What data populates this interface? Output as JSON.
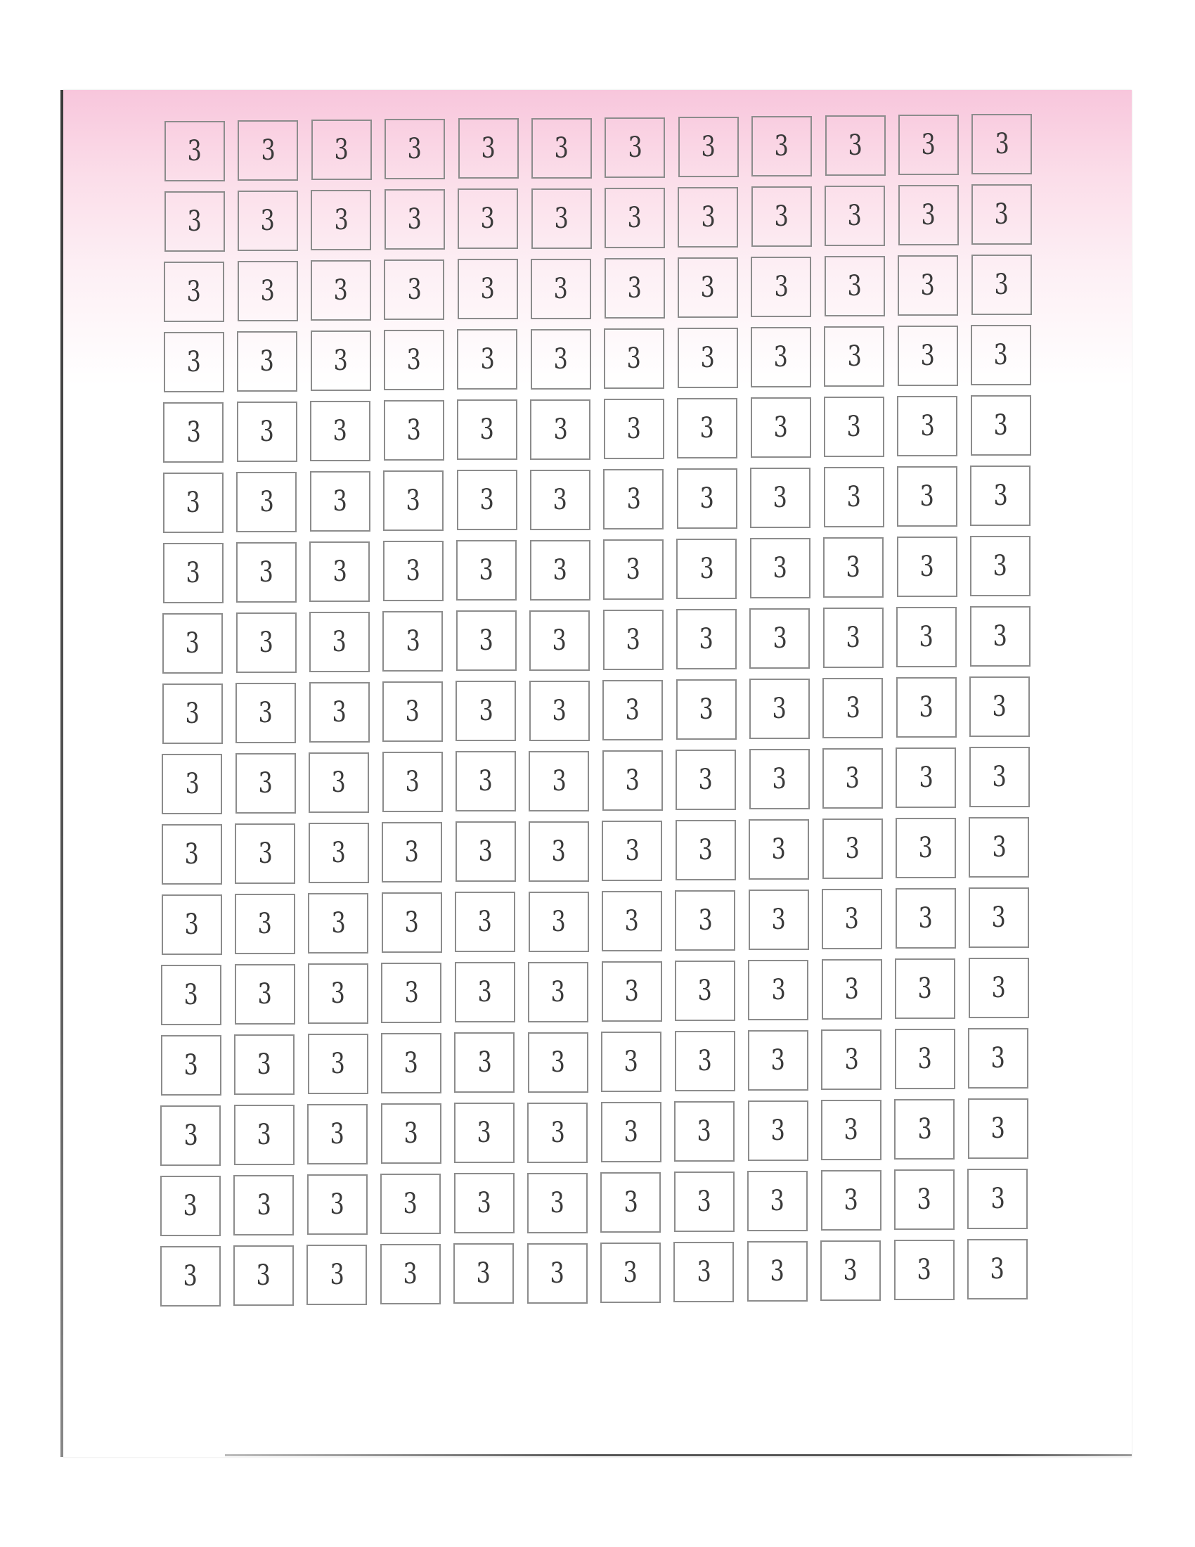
{
  "worksheet": {
    "rows": 17,
    "columns": 12,
    "cell_text": "3",
    "cells": [
      [
        "3",
        "3",
        "3",
        "3",
        "3",
        "3",
        "3",
        "3",
        "3",
        "3",
        "3",
        "3"
      ],
      [
        "3",
        "3",
        "3",
        "3",
        "3",
        "3",
        "3",
        "3",
        "3",
        "3",
        "3",
        "3"
      ],
      [
        "3",
        "3",
        "3",
        "3",
        "3",
        "3",
        "3",
        "3",
        "3",
        "3",
        "3",
        "3"
      ],
      [
        "3",
        "3",
        "3",
        "3",
        "3",
        "3",
        "3",
        "3",
        "3",
        "3",
        "3",
        "3"
      ],
      [
        "3",
        "3",
        "3",
        "3",
        "3",
        "3",
        "3",
        "3",
        "3",
        "3",
        "3",
        "3"
      ],
      [
        "3",
        "3",
        "3",
        "3",
        "3",
        "3",
        "3",
        "3",
        "3",
        "3",
        "3",
        "3"
      ],
      [
        "3",
        "3",
        "3",
        "3",
        "3",
        "3",
        "3",
        "3",
        "3",
        "3",
        "3",
        "3"
      ],
      [
        "3",
        "3",
        "3",
        "3",
        "3",
        "3",
        "3",
        "3",
        "3",
        "3",
        "3",
        "3"
      ],
      [
        "3",
        "3",
        "3",
        "3",
        "3",
        "3",
        "3",
        "3",
        "3",
        "3",
        "3",
        "3"
      ],
      [
        "3",
        "3",
        "3",
        "3",
        "3",
        "3",
        "3",
        "3",
        "3",
        "3",
        "3",
        "3"
      ],
      [
        "3",
        "3",
        "3",
        "3",
        "3",
        "3",
        "3",
        "3",
        "3",
        "3",
        "3",
        "3"
      ],
      [
        "3",
        "3",
        "3",
        "3",
        "3",
        "3",
        "3",
        "3",
        "3",
        "3",
        "3",
        "3"
      ],
      [
        "3",
        "3",
        "3",
        "3",
        "3",
        "3",
        "3",
        "3",
        "3",
        "3",
        "3",
        "3"
      ],
      [
        "3",
        "3",
        "3",
        "3",
        "3",
        "3",
        "3",
        "3",
        "3",
        "3",
        "3",
        "3"
      ],
      [
        "3",
        "3",
        "3",
        "3",
        "3",
        "3",
        "3",
        "3",
        "3",
        "3",
        "3",
        "3"
      ],
      [
        "3",
        "3",
        "3",
        "3",
        "3",
        "3",
        "3",
        "3",
        "3",
        "3",
        "3",
        "3"
      ],
      [
        "3",
        "3",
        "3",
        "3",
        "3",
        "3",
        "3",
        "3",
        "3",
        "3",
        "3",
        "3"
      ]
    ]
  },
  "colors": {
    "page_top_tint": "#f8c6dc",
    "box_border": "#8c8c8c",
    "ink": "#3a3a3a"
  }
}
